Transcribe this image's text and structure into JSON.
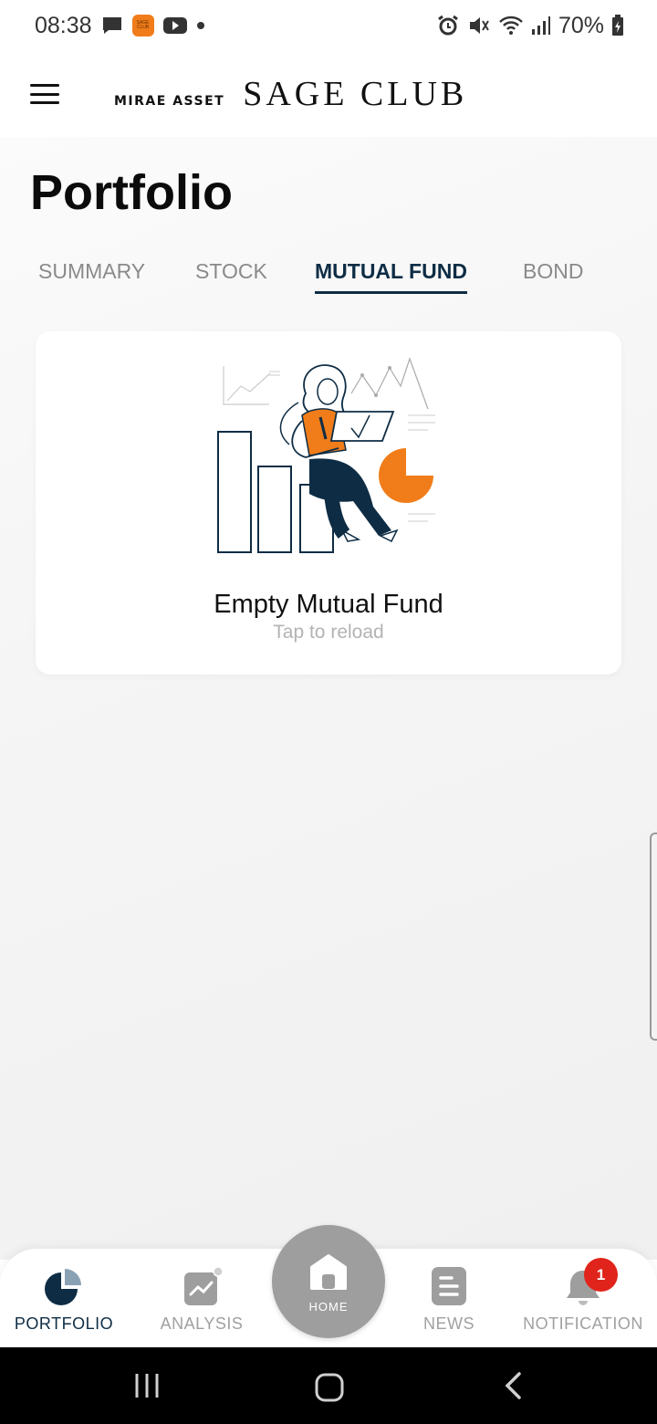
{
  "status_bar": {
    "time": "08:38",
    "battery": "70%",
    "app_icon_text": "SAGE CLUB"
  },
  "header": {
    "brand_small": "MIRAE ASSET",
    "brand_big": "SAGE CLUB"
  },
  "page": {
    "title": "Portfolio"
  },
  "tabs": [
    {
      "label": "SUMMARY",
      "active": false
    },
    {
      "label": "STOCK",
      "active": false
    },
    {
      "label": "MUTUAL FUND",
      "active": true
    },
    {
      "label": "BOND",
      "active": false
    }
  ],
  "empty_state": {
    "title": "Empty Mutual Fund",
    "subtitle": "Tap to reload"
  },
  "bottom_nav": {
    "items": [
      {
        "label": "PORTFOLIO",
        "icon": "pie-chart-icon",
        "active": true
      },
      {
        "label": "ANALYSIS",
        "icon": "analysis-icon",
        "active": false
      },
      {
        "label": "NEWS",
        "icon": "news-icon",
        "active": false
      },
      {
        "label": "NOTIFICATION",
        "icon": "bell-icon",
        "active": false
      }
    ],
    "home_label": "HOME",
    "notification_count": "1"
  },
  "colors": {
    "accent": "#0e2d45",
    "orange": "#f07d1a",
    "badge": "#e0241b",
    "inactive": "#a0a0a0"
  }
}
